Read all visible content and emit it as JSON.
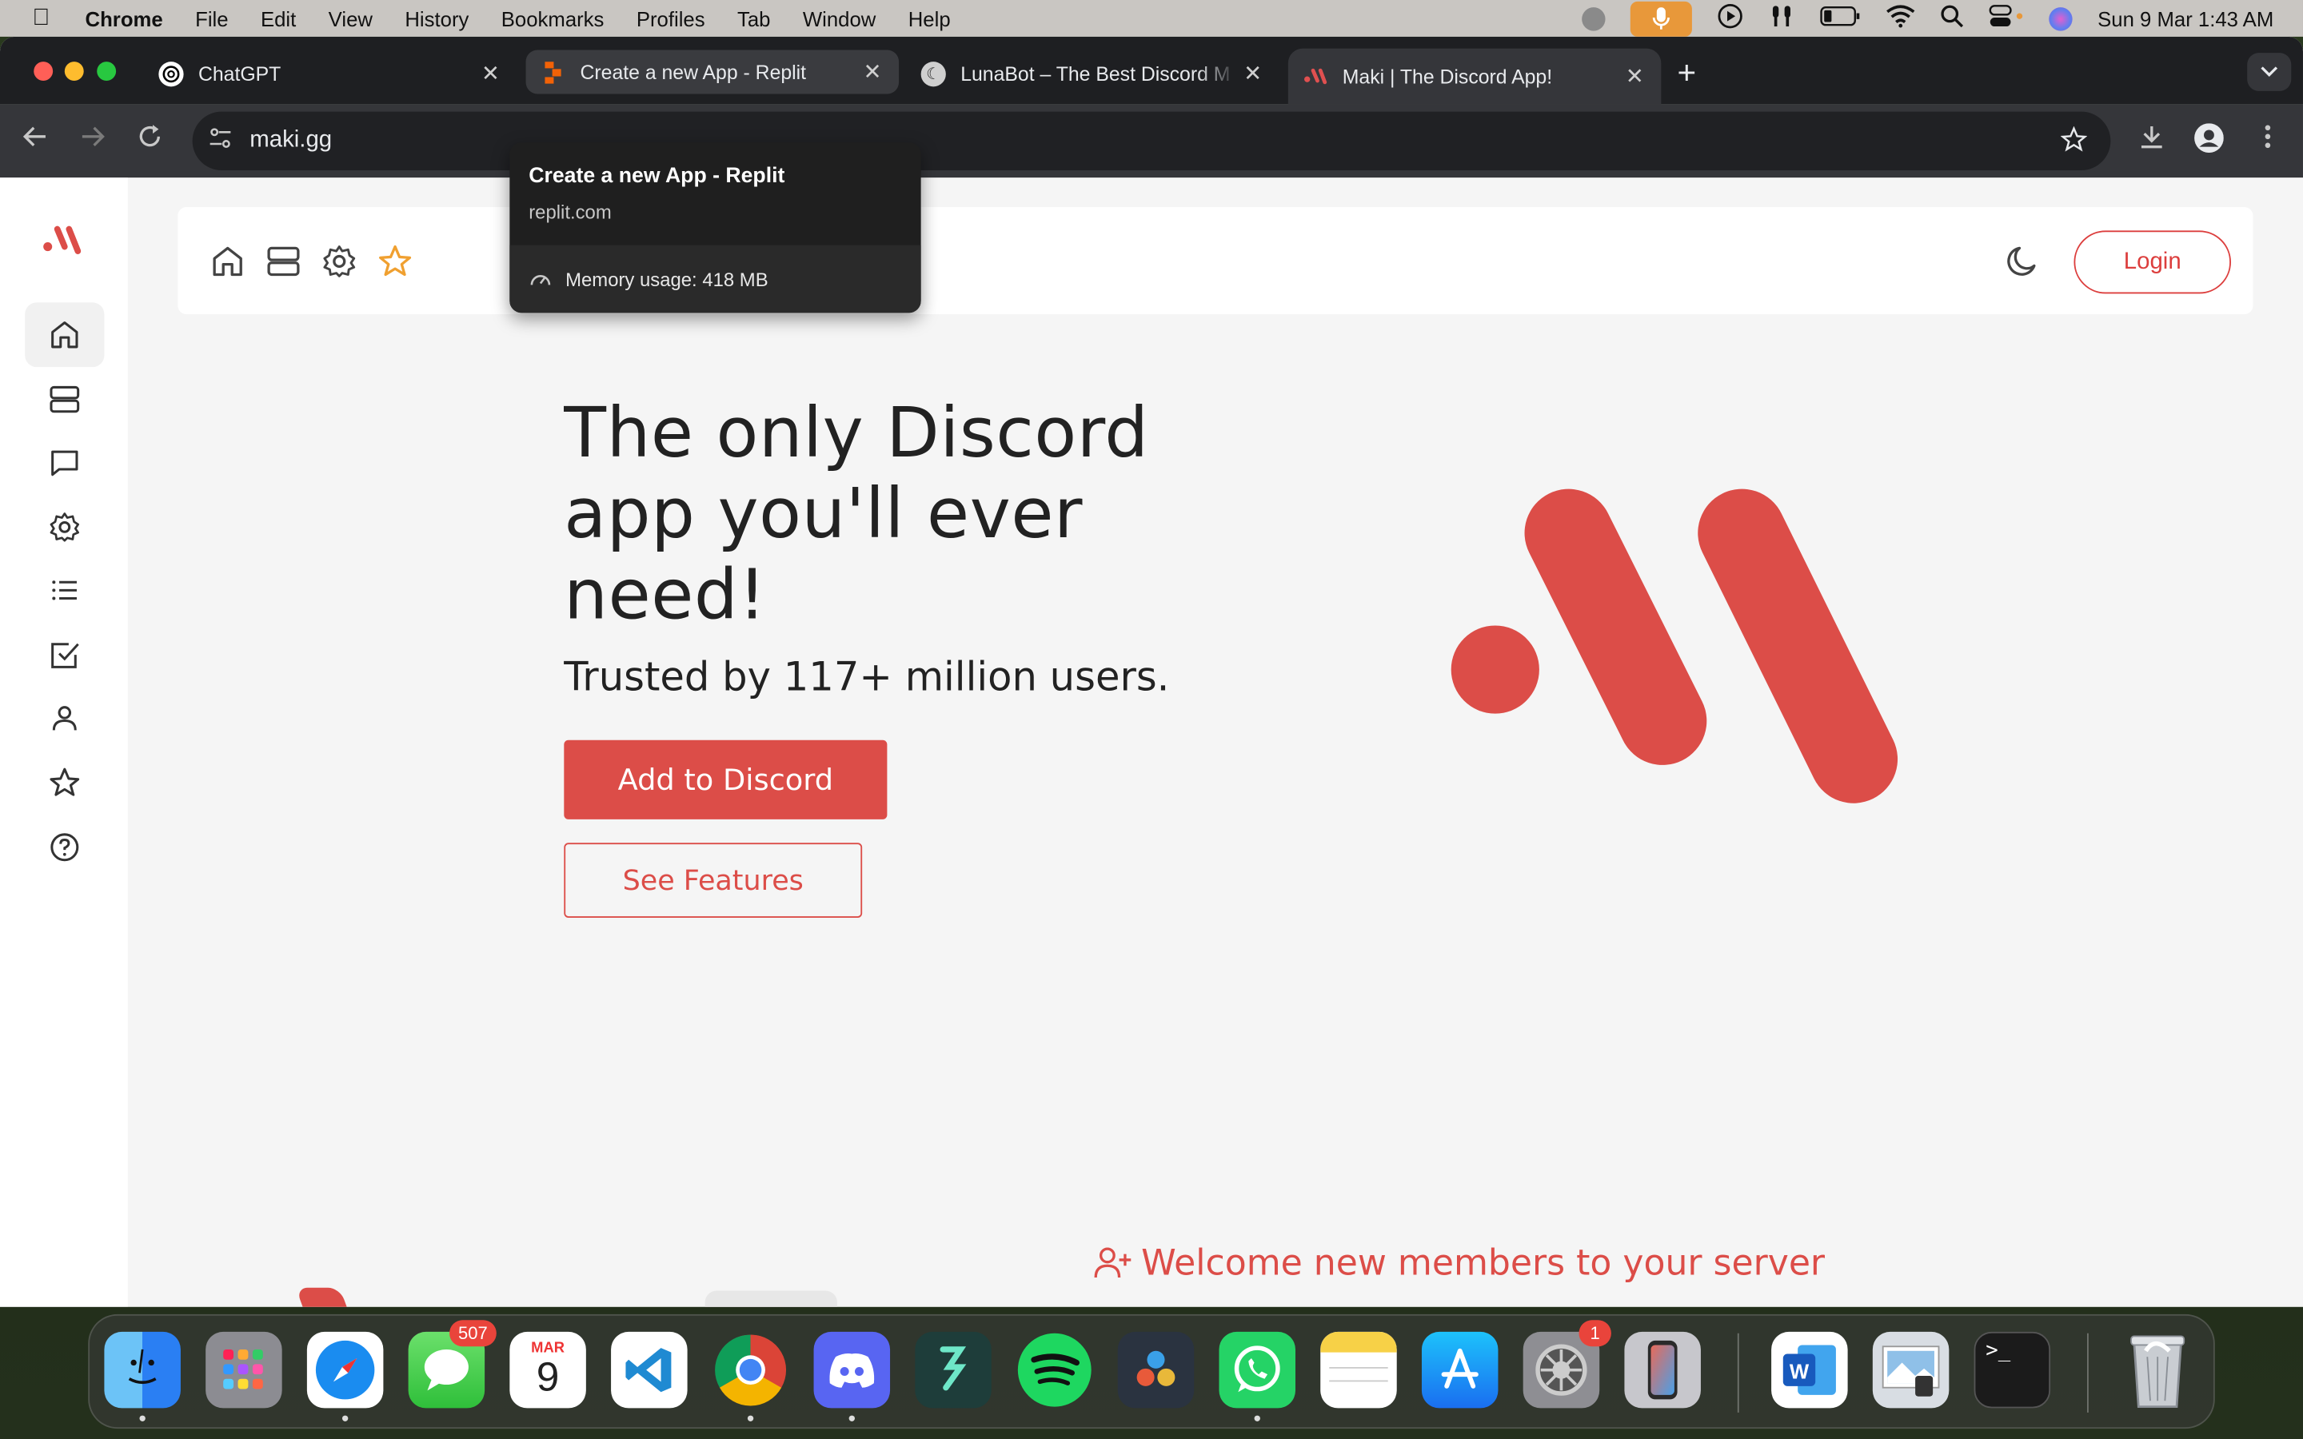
{
  "menubar": {
    "app": "Chrome",
    "items": [
      "File",
      "Edit",
      "View",
      "History",
      "Bookmarks",
      "Profiles",
      "Tab",
      "Window",
      "Help"
    ],
    "datetime": "Sun 9 Mar  1:43 AM"
  },
  "tabs": [
    {
      "title": "ChatGPT",
      "favicon": "chatgpt-icon"
    },
    {
      "title": "Create a new App - Replit",
      "favicon": "replit-icon"
    },
    {
      "title": "LunaBot – The Best Discord M",
      "favicon": "lunabot-icon"
    },
    {
      "title": "Maki | The Discord App!",
      "favicon": "maki-icon"
    }
  ],
  "omnibox": {
    "url": "maki.gg"
  },
  "tooltip": {
    "title": "Create a new App - Replit",
    "domain": "replit.com",
    "memory": "Memory usage: 418 MB"
  },
  "header": {
    "login": "Login"
  },
  "hero": {
    "title": "The only Discord app you'll ever need!",
    "subtitle": "Trusted by 117+ million users.",
    "add_button": "Add to Discord",
    "features_button": "See Features"
  },
  "section": {
    "welcome": "Welcome new members to your server"
  },
  "colors": {
    "brand": "#dc4d48",
    "accent_star": "#f0a030"
  },
  "dock": {
    "messages_badge": "507",
    "settings_badge": "1",
    "calendar_month": "MAR",
    "calendar_day": "9"
  }
}
